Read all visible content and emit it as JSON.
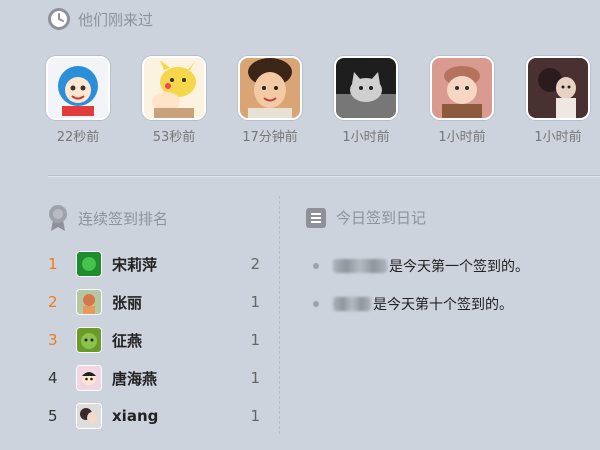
{
  "recent_visitors": {
    "title": "他们刚来过",
    "items": [
      {
        "time": "22秒前",
        "avatar": "cartoon-doraemon-costume"
      },
      {
        "time": "53秒前",
        "avatar": "cartoon-pikachu-costume"
      },
      {
        "time": "17分钟前",
        "avatar": "child-photo"
      },
      {
        "time": "1小时前",
        "avatar": "cat-photo"
      },
      {
        "time": "1小时前",
        "avatar": "baby-photo"
      },
      {
        "time": "1小时前",
        "avatar": "dark-child-photo"
      }
    ]
  },
  "checkin_ranking": {
    "title": "连续签到排名",
    "rows": [
      {
        "rank": "1",
        "name": "宋莉萍",
        "count": "2"
      },
      {
        "rank": "2",
        "name": "张丽",
        "count": "1"
      },
      {
        "rank": "3",
        "name": "征燕",
        "count": "1"
      },
      {
        "rank": "4",
        "name": "唐海燕",
        "count": "1"
      },
      {
        "rank": "5",
        "name": "xiang",
        "count": "1"
      }
    ]
  },
  "diary": {
    "title": "今日签到日记",
    "items": [
      {
        "text": "是今天第一个签到的。"
      },
      {
        "text": "是今天第十个签到的。"
      }
    ]
  },
  "colors": {
    "background": "#ccd3dd",
    "rank_highlight": "#f07b17",
    "muted_text": "#8a939e"
  }
}
